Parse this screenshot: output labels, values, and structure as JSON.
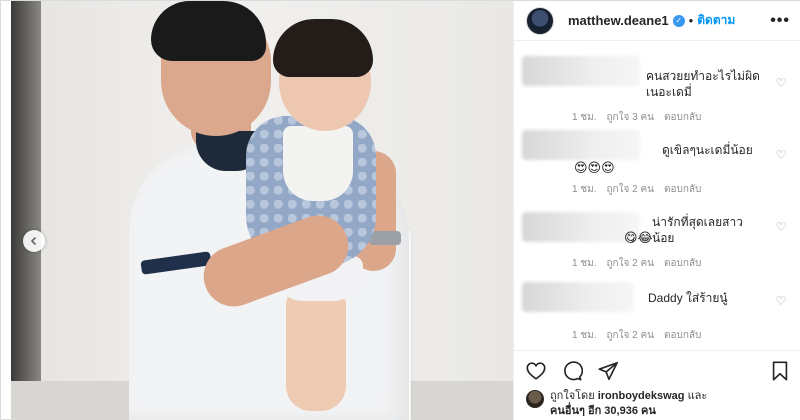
{
  "header": {
    "username": "matthew.deane1",
    "separator": "•",
    "follow_label": "ติดตาม",
    "more_label": "•••"
  },
  "photo": {
    "prev_icon": "chevron-left-icon"
  },
  "comments": [
    {
      "text": "คนสวยยทำอะไรไม่ผิดเนอะเดมี่",
      "time": "1 ชม.",
      "likes": "ถูกใจ 3 คน",
      "reply": "ตอบกลับ"
    },
    {
      "text": "ดูเขิลๆนะเดมี่น้อย",
      "emoji": "😍😍😍",
      "time": "1 ชม.",
      "likes": "ถูกใจ 2 คน",
      "reply": "ตอบกลับ"
    },
    {
      "text": "น่ารักที่สุดเลยสาวน้อย",
      "emoji": "😋😂",
      "time": "1 ชม.",
      "likes": "ถูกใจ 2 คน",
      "reply": "ตอบกลับ"
    },
    {
      "text": "Daddy ใส่ร้ายนู๋",
      "time": "1 ชม.",
      "likes": "ถูกใจ 2 คน",
      "reply": "ตอบกลับ"
    }
  ],
  "actions": {
    "icons": [
      "heart-icon",
      "comment-icon",
      "share-icon",
      "bookmark-icon"
    ]
  },
  "likes": {
    "prefix": "ถูกใจโดย",
    "liker": "ironboydekswag",
    "conjunction": "และ",
    "others": "คนอื่นๆ อีก 30,936 คน"
  },
  "colors": {
    "accent": "#0095f6",
    "verified": "#3897f0",
    "muted": "#8e8e8e",
    "text": "#262626"
  }
}
